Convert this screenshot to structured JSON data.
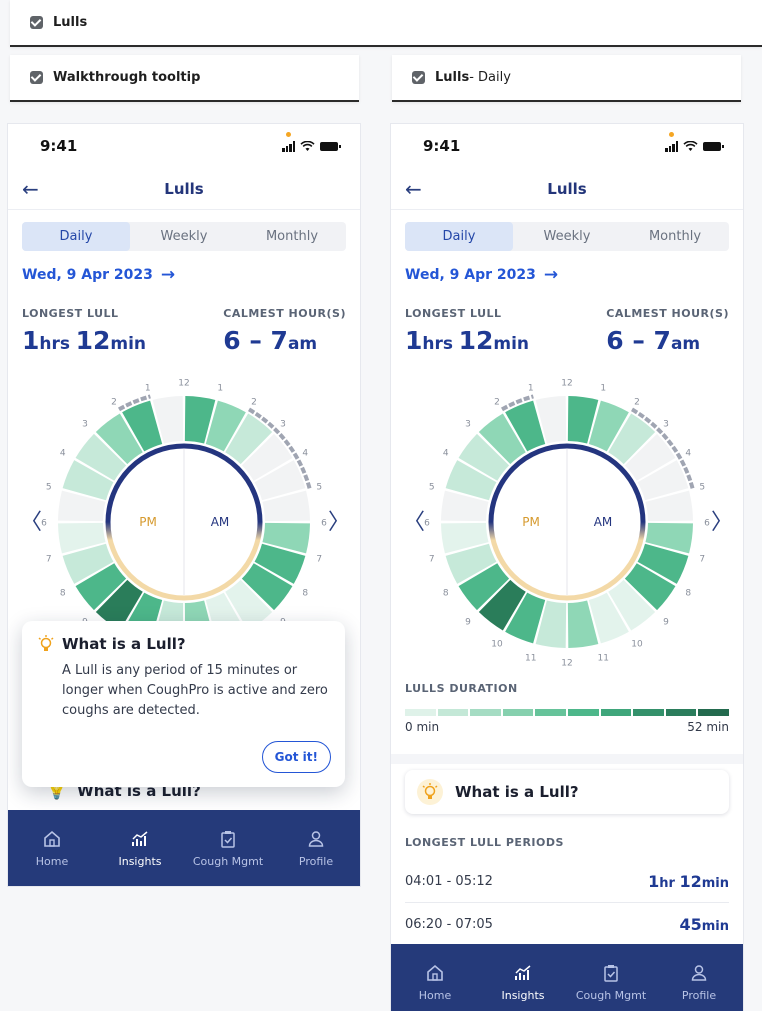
{
  "labels": {
    "top": {
      "title": "Lulls"
    },
    "left": {
      "title": "Walkthrough tooltip"
    },
    "right": {
      "title": "Lulls",
      "subtitle": " - Daily"
    }
  },
  "status_bar": {
    "time": "9:41"
  },
  "screen": {
    "title": "Lulls",
    "tabs": [
      "Daily",
      "Weekly",
      "Monthly"
    ],
    "active_tab": "Daily",
    "date": "Wed, 9 Apr 2023",
    "longest_lull": {
      "label": "LONGEST LULL",
      "hours": "1",
      "hours_unit": "hrs",
      "minutes": "12",
      "minutes_unit": "min"
    },
    "calmest_hours": {
      "label": "CALMEST HOUR(S)",
      "range": "6 – 7",
      "unit": "am"
    },
    "dial": {
      "pm_label": "PM",
      "am_label": "AM",
      "hour_labels": [
        "12",
        "1",
        "2",
        "3",
        "4",
        "5",
        "6",
        "7",
        "8",
        "9",
        "10",
        "11",
        "12",
        "11",
        "10",
        "9",
        "8",
        "7",
        "6",
        "5",
        "4",
        "3",
        "2",
        "1"
      ],
      "segment_levels": [
        4,
        3,
        2,
        0,
        0,
        0,
        3,
        4,
        4,
        1,
        1,
        3,
        2,
        4,
        5,
        4,
        2,
        1,
        0,
        2,
        2,
        3,
        4,
        0
      ],
      "level_colors": [
        "#f2f3f4",
        "#e3f3ec",
        "#c6e9d9",
        "#8fd7b6",
        "#4db78a",
        "#2a7d5a"
      ]
    }
  },
  "tooltip": {
    "title": "What is a Lull?",
    "body": "A Lull is any period of 15 minutes or longer when CoughPro is active and zero coughs are detected.",
    "button": "Got it!"
  },
  "info_card": {
    "title": "What is a Lull?"
  },
  "duration": {
    "label": "LULLS DURATION",
    "min_label": "0 min",
    "max_label": "52 min",
    "steps": [
      "#dff2e9",
      "#c4e8d7",
      "#a5dcc3",
      "#86d0ae",
      "#66c39a",
      "#4db78a",
      "#3fa67b",
      "#34916b",
      "#2b7d5c",
      "#236a4e"
    ]
  },
  "periods": {
    "label": "LONGEST LULL PERIODS",
    "rows": [
      {
        "range": "04:01 - 05:12",
        "h": "1",
        "h_unit": "hr",
        "m": "12",
        "m_unit": "min"
      },
      {
        "range": "06:20 - 07:05",
        "m": "45",
        "m_unit": "min"
      }
    ]
  },
  "bottom_nav": {
    "items": [
      {
        "label": "Home",
        "icon": "home-icon"
      },
      {
        "label": "Insights",
        "icon": "insights-icon"
      },
      {
        "label": "Cough Mgmt",
        "icon": "clipboard-icon"
      },
      {
        "label": "Profile",
        "icon": "profile-icon"
      }
    ],
    "active": "Insights"
  }
}
